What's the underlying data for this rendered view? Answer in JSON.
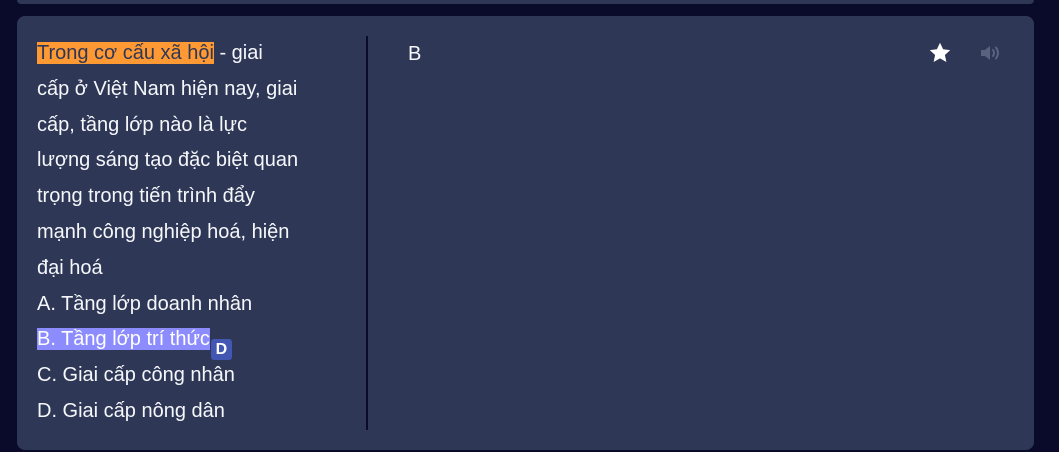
{
  "card": {
    "term": {
      "highlight_orange": "Trong cơ cấu xã hội",
      "line1_rest": " - giai",
      "line2": "cấp ở Việt Nam hiện nay, giai",
      "line3": "cấp, tầng lớp nào là lực",
      "line4": "lượng sáng tạo đặc biệt quan",
      "line5": "trọng trong tiến trình đẩy",
      "line6": "mạnh công nghiệp hoá, hiện",
      "line7": "đại hoá",
      "option_a": "A. Tầng lớp doanh nhân",
      "option_b": "B. Tầng lớp trí thức",
      "option_b_badge": "D",
      "option_c": "C. Giai cấp công nhân",
      "option_d": "D. Giai cấp nông dân"
    },
    "definition": "B",
    "icons": {
      "star": "star-icon",
      "audio": "speaker-icon"
    },
    "colors": {
      "card_bg": "#2e3856",
      "page_bg": "#0a0a2a",
      "orange_highlight": "#ff9933",
      "blue_highlight": "#8c8cff",
      "badge_bg": "#4257b2",
      "text": "#f6f7fb",
      "audio_icon": "#586380"
    }
  }
}
